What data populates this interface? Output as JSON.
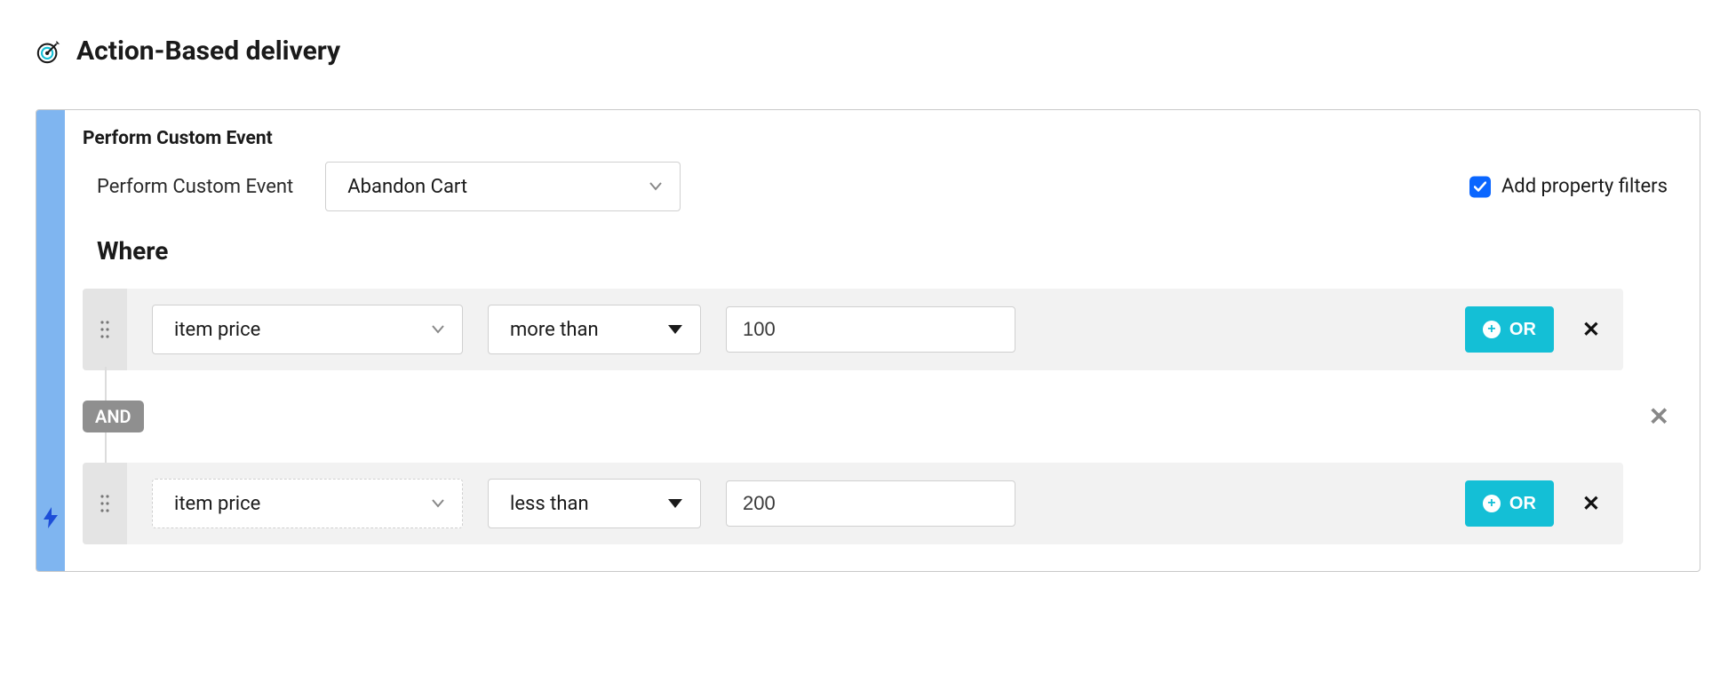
{
  "header": {
    "title": "Action-Based delivery"
  },
  "event": {
    "section_title": "Perform Custom Event",
    "label": "Perform Custom Event",
    "selected": "Abandon Cart",
    "prop_filters_label": "Add property filters",
    "prop_filters_checked": true
  },
  "where": {
    "title": "Where",
    "connector": "AND",
    "or_label": "OR",
    "rows": [
      {
        "property": "item price",
        "operator": "more than",
        "value": "100"
      },
      {
        "property": "item price",
        "operator": "less than",
        "value": "200"
      }
    ]
  }
}
